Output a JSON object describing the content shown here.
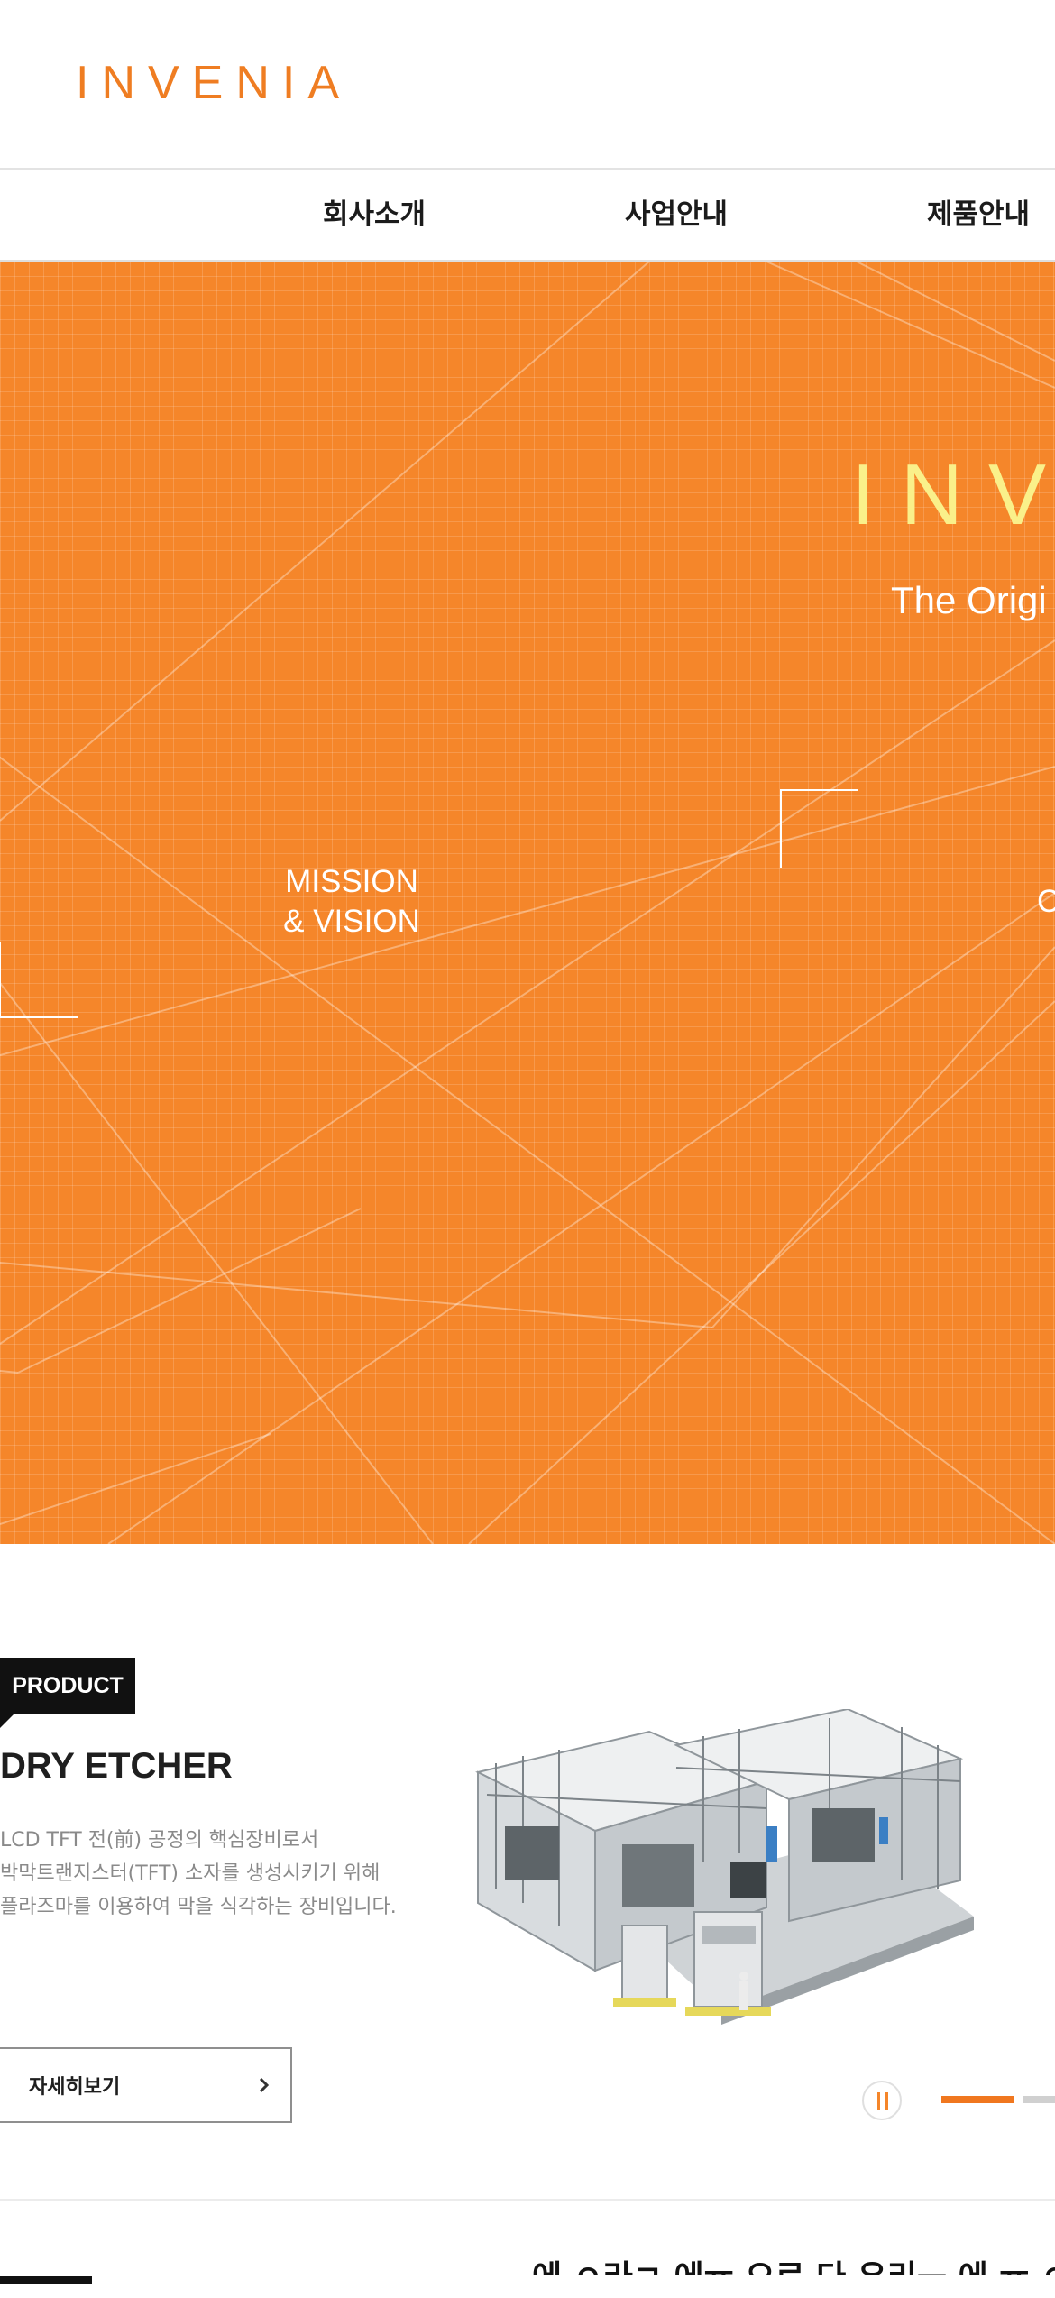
{
  "header": {
    "logo": "INVENIA",
    "brand_color": "#ef7d22"
  },
  "gnb": {
    "items": [
      "회사소개",
      "사업안내",
      "제품안내"
    ]
  },
  "hero": {
    "background_color": "#f5862a",
    "brand_text": "INV",
    "tagline": "The Origi",
    "mission_line1": "MISSION",
    "mission_line2": "& VISION",
    "right_fragment": "C"
  },
  "product": {
    "badge": "PRODUCT",
    "title": "DRY ETCHER",
    "desc": [
      "LCD TFT 전(前) 공정의 핵심장비로서",
      "박막트랜지스터(TFT) 소자를 생성시키기 위해",
      "플라즈마를 이용하여 막을 식각하는 장비입니다."
    ],
    "more_label": "자세히보기",
    "slider": {
      "total_visible_dots": 2,
      "active_index": 0,
      "paused_icon": "pause-icon"
    }
  },
  "bottom": {
    "partial_heading": "에 ㅇ라ㄱ 에ㅠ 으로 다 우리ㅡ 에 ㅠ ㅇ"
  }
}
